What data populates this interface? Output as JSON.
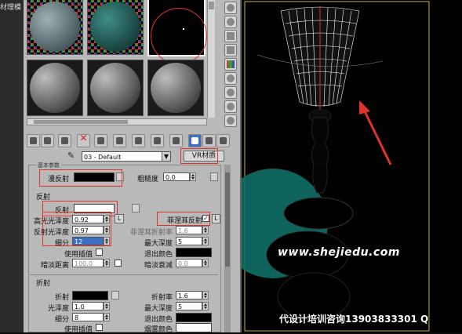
{
  "left_panel": {
    "label": "材理模"
  },
  "editor": {
    "material_name": "03 - Default",
    "type_button": "VR材质",
    "rollout_name": "基本参数",
    "diffuse": {
      "label": "漫反射",
      "roughness_label": "粗糙度",
      "roughness_value": "0.0"
    },
    "reflection": {
      "section": "反射",
      "reflect_label": "反射",
      "hilight_gloss_label": "高光光泽度",
      "hilight_gloss_value": "0.92",
      "refl_gloss_label": "反射光泽度",
      "refl_gloss_value": "0.97",
      "subdivs_label": "细分",
      "subdivs_value": "12",
      "use_interp_label": "使用插值",
      "dim_distance_label": "暗淡距离",
      "dim_distance_value": "100.0",
      "l_label": "L",
      "fresnel_label": "菲涅耳反射",
      "fresnel_check": "✓",
      "fresnel_ior_label": "菲涅耳折射率",
      "fresnel_ior_value": "1.6",
      "max_depth_label": "最大深度",
      "max_depth_value": "5",
      "exit_color_label": "退出颜色",
      "dim_falloff_label": "暗淡衰减",
      "dim_falloff_value": "0.0"
    },
    "refraction": {
      "section": "折射",
      "refract_label": "折射",
      "gloss_label": "光泽度",
      "gloss_value": "1.0",
      "subdivs_label": "细分",
      "subdivs_value": "8",
      "use_interp_label": "使用插值",
      "ior_label": "折射率",
      "ior_value": "1.6",
      "max_depth_label": "最大深度",
      "max_depth_value": "5",
      "exit_color_label": "退出颜色",
      "fog_color_label": "烟雾颜色"
    }
  },
  "viewport": {
    "watermark": "www.shejiedu.com",
    "footer_text": "代设计培训咨询13903833301 Q"
  },
  "colors": {
    "annotation_red": "#e0342b",
    "wire": "#ffffff",
    "selection_yellow": "#c8b432"
  },
  "icons": [
    "sample-sphere-icon",
    "backlight-icon",
    "background-icon",
    "uv-tiling-icon",
    "video-color-check-icon",
    "make-preview-icon",
    "options-icon",
    "select-by-material-icon",
    "material-navigator-icon",
    "get-material-icon",
    "put-to-scene-icon",
    "assign-to-selection-icon",
    "reset-map-icon",
    "copy-material-icon",
    "make-unique-icon",
    "put-to-library-icon",
    "material-id-icon",
    "show-map-icon",
    "show-end-result-icon",
    "go-to-parent-icon",
    "go-forward-icon",
    "eyedropper-icon"
  ]
}
